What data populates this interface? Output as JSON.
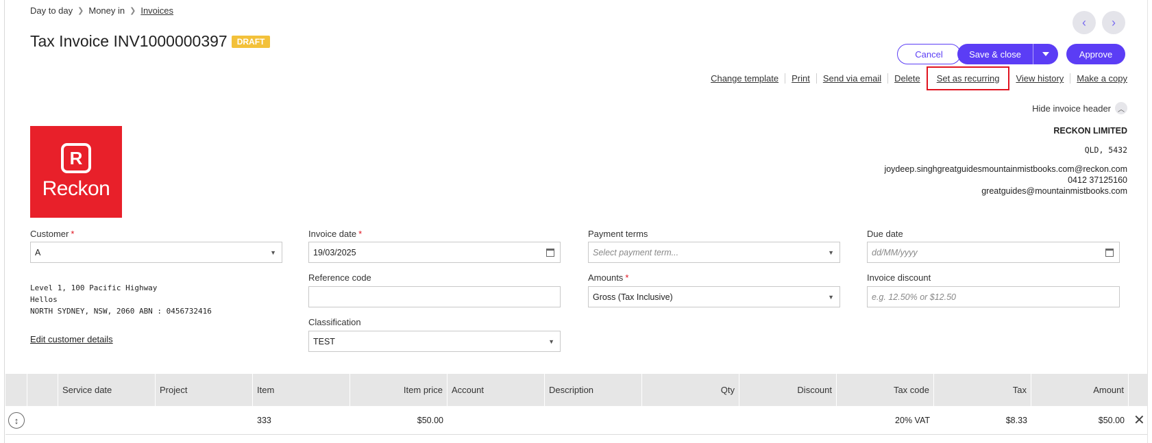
{
  "breadcrumb": {
    "items": [
      "Day to day",
      "Money in"
    ],
    "current": "Invoices"
  },
  "nav": {
    "prev": "‹",
    "next": "›"
  },
  "title": {
    "text": "Tax Invoice INV1000000397",
    "badge": "DRAFT"
  },
  "buttons": {
    "cancel": "Cancel",
    "save": "Save & close",
    "approve": "Approve"
  },
  "actions": [
    "Change template",
    "Print",
    "Send via email",
    "Delete",
    "Set as recurring",
    "View history",
    "Make a copy"
  ],
  "hide_header": "Hide invoice header",
  "logo": {
    "mark": "R",
    "word": "Reckon"
  },
  "company": {
    "name": "RECKON LIMITED",
    "location": "QLD, 5432",
    "email1": "joydeep.singhgreatguidesmountainmistbooks.com@reckon.com",
    "phone": "0412  37125160",
    "email2": "greatguides@mountainmistbooks.com"
  },
  "fields": {
    "customer": {
      "label": "Customer",
      "value": "A"
    },
    "invoice_date": {
      "label": "Invoice date",
      "value": "19/03/2025"
    },
    "payment_terms": {
      "label": "Payment terms",
      "placeholder": "Select payment term..."
    },
    "due_date": {
      "label": "Due date",
      "placeholder": "dd/MM/yyyy"
    },
    "reference_code": {
      "label": "Reference code",
      "value": ""
    },
    "amounts": {
      "label": "Amounts",
      "value": "Gross (Tax Inclusive)"
    },
    "invoice_discount": {
      "label": "Invoice discount",
      "placeholder": "e.g. 12.50% or $12.50"
    },
    "classification": {
      "label": "Classification",
      "value": "TEST"
    }
  },
  "address": [
    "Level 1, 100 Pacific Highway",
    "Hellos",
    "NORTH SYDNEY, NSW, 2060 ABN : 0456732416"
  ],
  "edit_customer": "Edit customer details",
  "table": {
    "headers": [
      "Service date",
      "Project",
      "Item",
      "Item price",
      "Account",
      "Description",
      "Qty",
      "Discount",
      "Tax code",
      "Tax",
      "Amount"
    ],
    "row": {
      "service_date": "",
      "project": "",
      "item": "333",
      "item_price": "$50.00",
      "account": "",
      "description": "",
      "qty": "",
      "discount": "",
      "tax_code": "20% VAT",
      "tax": "$8.33",
      "amount": "$50.00"
    }
  },
  "colors": {
    "accent": "#5b3df5",
    "brand_red": "#e8202a",
    "badge": "#f3c13a",
    "highlight": "#e0131f"
  }
}
